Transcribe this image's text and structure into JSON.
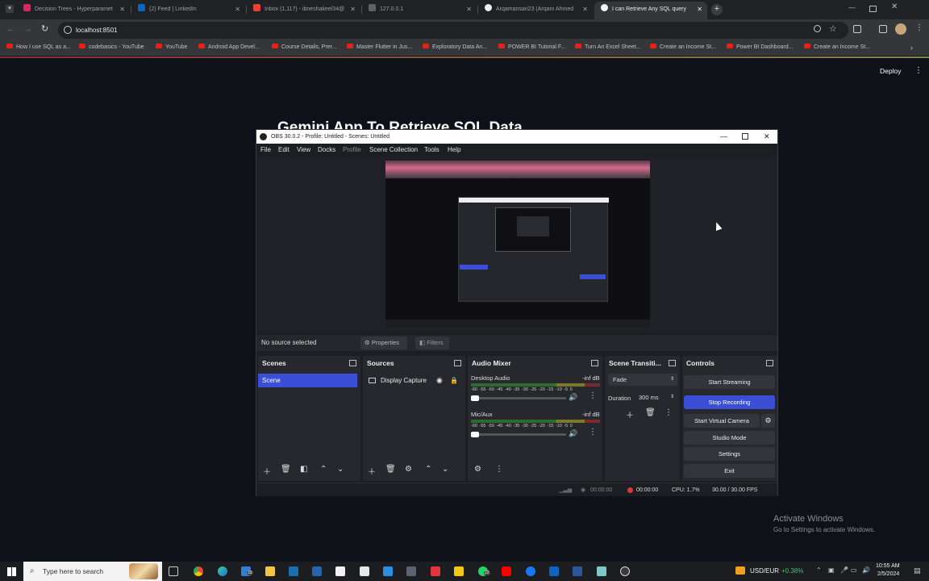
{
  "browser": {
    "tabs": [
      {
        "title": "Decision Trees - Hyperparamet",
        "color": "#e0245e"
      },
      {
        "title": "(2) Feed | LinkedIn",
        "color": "#0a66c2"
      },
      {
        "title": "Inbox (1,117) - ibneshakeel34@",
        "color": "#ea4335"
      },
      {
        "title": "127.0.0.1",
        "color": "#5f6368"
      },
      {
        "title": "Arqamansari23 (Arqam Ahmed",
        "color": "#f0f0f0"
      },
      {
        "title": "I can Retrieve Any SQL query",
        "color": "#f5f5f5"
      }
    ],
    "url": "localhost:8501",
    "bookmarks": [
      "How I use SQL as a...",
      "codebasics - YouTube",
      "YouTube",
      "Android App Devel...",
      "Course Details, Prer...",
      "Master Flutter in Jus...",
      "Exploratory Data An...",
      "POWER BI Tutorial F...",
      "Turn An Excel Sheet...",
      "Create an Income St...",
      "Power BI Dashboard...",
      "Create an Income St..."
    ]
  },
  "app": {
    "deploy_label": "Deploy",
    "heading": "Gemini App To Retrieve SQL Data"
  },
  "obs": {
    "title": "OBS 30.0.2 - Profile: Untitled - Scenes: Untitled",
    "menu": [
      "File",
      "Edit",
      "View",
      "Docks",
      "Profile",
      "Scene Collection",
      "Tools",
      "Help"
    ],
    "no_source": "No source selected",
    "properties": "Properties",
    "filters": "Filters",
    "scenes": {
      "header": "Scenes",
      "items": [
        "Scene"
      ]
    },
    "sources": {
      "header": "Sources",
      "items": [
        "Display Capture"
      ]
    },
    "audio": {
      "header": "Audio Mixer",
      "channels": [
        {
          "name": "Desktop Audio",
          "level": "-inf dB"
        },
        {
          "name": "Mic/Aux",
          "level": "-inf dB"
        }
      ],
      "scale": [
        "-60",
        "-55",
        "-50",
        "-45",
        "-40",
        "-35",
        "-30",
        "-25",
        "-20",
        "-15",
        "-10",
        "-5",
        "0"
      ]
    },
    "transitions": {
      "header": "Scene Transiti...",
      "type": "Fade",
      "duration_label": "Duration",
      "duration_value": "300 ms"
    },
    "controls": {
      "header": "Controls",
      "start_streaming": "Start Streaming",
      "stop_recording": "Stop Recording",
      "start_virtual_camera": "Start Virtual Camera",
      "studio_mode": "Studio Mode",
      "settings": "Settings",
      "exit": "Exit"
    },
    "status": {
      "stream_time": "00:00:00",
      "rec_time": "00:00:00",
      "cpu": "CPU: 1.7%",
      "fps": "30.00 / 30.00 FPS"
    },
    "accent": "#3b4fd6"
  },
  "windows": {
    "activate_title": "Activate Windows",
    "activate_sub": "Go to Settings to activate Windows.",
    "search_placeholder": "Type here to search",
    "badge_a": "33",
    "badge_b": "22",
    "ticker": "USD/EUR",
    "ticker_change": "+0.38%",
    "time": "10:55 AM",
    "date": "2/5/2024"
  }
}
